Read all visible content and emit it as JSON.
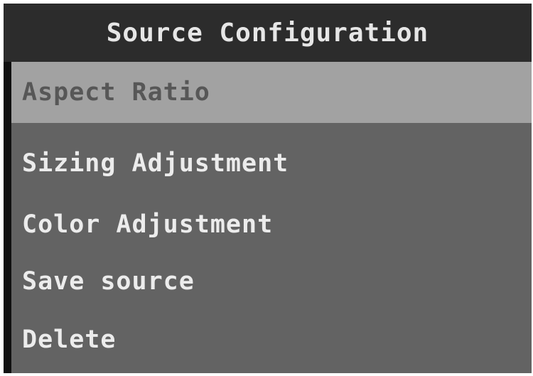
{
  "window": {
    "title": "Source Configuration"
  },
  "menu": {
    "items": [
      {
        "label": "Aspect Ratio",
        "selected": true
      },
      {
        "label": "Sizing Adjustment",
        "selected": false
      },
      {
        "label": "Color Adjustment",
        "selected": false
      },
      {
        "label": "Save source",
        "selected": false
      },
      {
        "label": "Delete",
        "selected": false
      }
    ]
  },
  "colors": {
    "title_bar": "#2c2c2c",
    "panel": "#636363",
    "selected_row": "#a2a2a2",
    "text": "#ececec",
    "selected_text": "#575757"
  }
}
